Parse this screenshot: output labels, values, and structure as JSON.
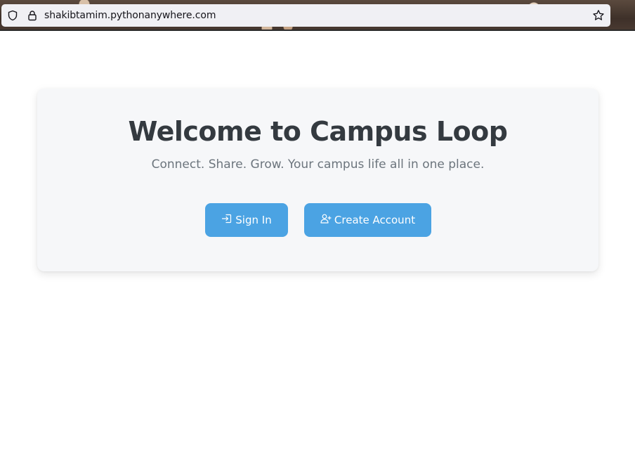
{
  "browser": {
    "url": "shakibtamim.pythonanywhere.com",
    "icons": {
      "site_info": "shield-icon",
      "secure": "lock-icon",
      "bookmark": "star-icon"
    }
  },
  "hero": {
    "title": "Welcome to Campus Loop",
    "subtitle": "Connect. Share. Grow. Your campus life all in one place."
  },
  "actions": {
    "sign_in_label": "Sign In",
    "sign_in_icon": "sign-in-icon",
    "create_account_label": "Create Account",
    "create_account_icon": "user-plus-icon"
  },
  "colors": {
    "accent": "#4ba3e3",
    "title": "#343a40",
    "subtitle": "#6c757d",
    "card_background": "#f6f7f9"
  }
}
